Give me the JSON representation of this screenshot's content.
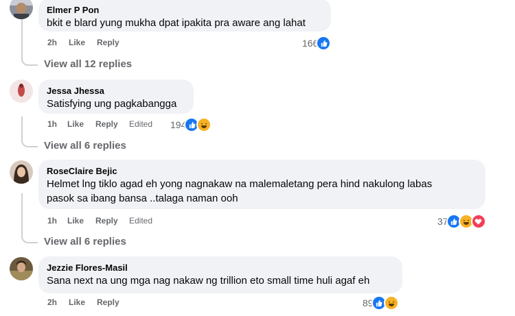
{
  "comments": [
    {
      "author": "Elmer P Pon",
      "text": "bkit e blard yung mukha dpat ipakita pra aware ang lahat",
      "time": "2h",
      "like": "Like",
      "reply": "Reply",
      "edited": "",
      "reaction_count": "166",
      "reactions": [
        "like-icon"
      ],
      "view_replies": "View all 12 replies"
    },
    {
      "author": "Jessa Jhessa",
      "text": "Satisfying ung pagkabangga",
      "time": "1h",
      "like": "Like",
      "reply": "Reply",
      "edited": "Edited",
      "reaction_count": "194",
      "reactions": [
        "like-icon",
        "haha-icon"
      ],
      "view_replies": "View all 6 replies"
    },
    {
      "author": "RoseClaire Bejic",
      "text_line1": "Helmet lng tiklo agad eh yong nagnakaw na malemaletang pera hind nakulong labas",
      "text_line2": "pasok sa ibang bansa ..talaga naman ooh",
      "time": "1h",
      "like": "Like",
      "reply": "Reply",
      "edited": "Edited",
      "reaction_count": "37",
      "reactions": [
        "like-icon",
        "haha-icon",
        "love-icon"
      ],
      "view_replies": "View all 6 replies"
    },
    {
      "author": "Jezzie Flores-Masil",
      "text": "Sana next na ung mga nag nakaw ng trillion eto small time huli agaf eh",
      "time": "2h",
      "like": "Like",
      "reply": "Reply",
      "edited": "",
      "reaction_count": "89",
      "reactions": [
        "like-icon",
        "haha-icon"
      ]
    }
  ]
}
